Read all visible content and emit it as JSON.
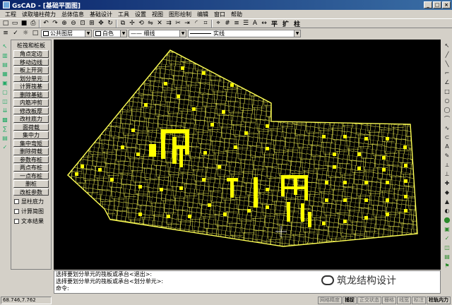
{
  "window": {
    "title": "GsCAD - [基础平面图]",
    "buttons": [
      "_",
      "□",
      "×"
    ]
  },
  "menu": [
    "工程",
    "读取墙柱荷力",
    "总体信息",
    "基础设计",
    "工具",
    "设置",
    "视图",
    "图形绘制",
    "编辑",
    "窗口",
    "帮助"
  ],
  "toolbar1": {
    "icons": [
      "new-icon",
      "open-icon",
      "save-icon",
      "print-icon",
      "undo-icon",
      "redo-icon",
      "zoom-in-icon",
      "zoom-out-icon",
      "zoom-window-icon",
      "zoom-all-icon",
      "pan-icon",
      "refresh-icon",
      "copy-icon",
      "move-icon",
      "rotate-icon",
      "mirror-icon",
      "erase-icon",
      "offset-icon",
      "trim-icon",
      "extend-icon",
      "fillet-icon",
      "measure-icon",
      "snap-icon",
      "grid-icon",
      "layer-icon",
      "property-icon",
      "text-icon",
      "dim-icon"
    ],
    "text_buttons": [
      "平",
      "扩",
      "柱"
    ]
  },
  "toolbar2": {
    "layer": "公共图层",
    "color": "白色",
    "color_hex": "#ffffff",
    "linewidth": "—— 细线",
    "linetype": "实线"
  },
  "panel": {
    "title": "桩筏和桩板",
    "buttons": [
      "角点定边",
      "移动边线",
      "板上开洞",
      "划分单元",
      "计算筏基",
      "删除基础",
      "内筋冲剪",
      "修改板厚",
      "改柱底力",
      "面荷载",
      "集中力",
      "集中弯矩",
      "删除荷载",
      "参数布桩",
      "两点布桩",
      "一点布桩",
      "删桩",
      "改桩参数"
    ],
    "checkboxes": [
      "显柱底力",
      "计算简图",
      "文本结果"
    ]
  },
  "command": {
    "lines": [
      "选择要划分单元的筏板或承台<退出>:",
      "选择要划分单元的筏板或承台<划分单元>:",
      "命令:"
    ]
  },
  "status": {
    "coord": "68.746,7.762",
    "toggles": [
      {
        "label": "网格精度",
        "on": false
      },
      {
        "label": "捕捉",
        "on": true
      },
      {
        "label": "正交状态",
        "on": false
      },
      {
        "label": "栅格",
        "on": false
      },
      {
        "label": "线宽",
        "on": false
      },
      {
        "label": "标注",
        "on": false
      },
      {
        "label": "柱轨内力",
        "on": true
      }
    ]
  },
  "watermark": "筑龙结构设计",
  "colors": {
    "mesh": "#ffff55",
    "column": "#ffff00",
    "canvas_bg": "#000000",
    "titlebar": "#0a246a"
  }
}
